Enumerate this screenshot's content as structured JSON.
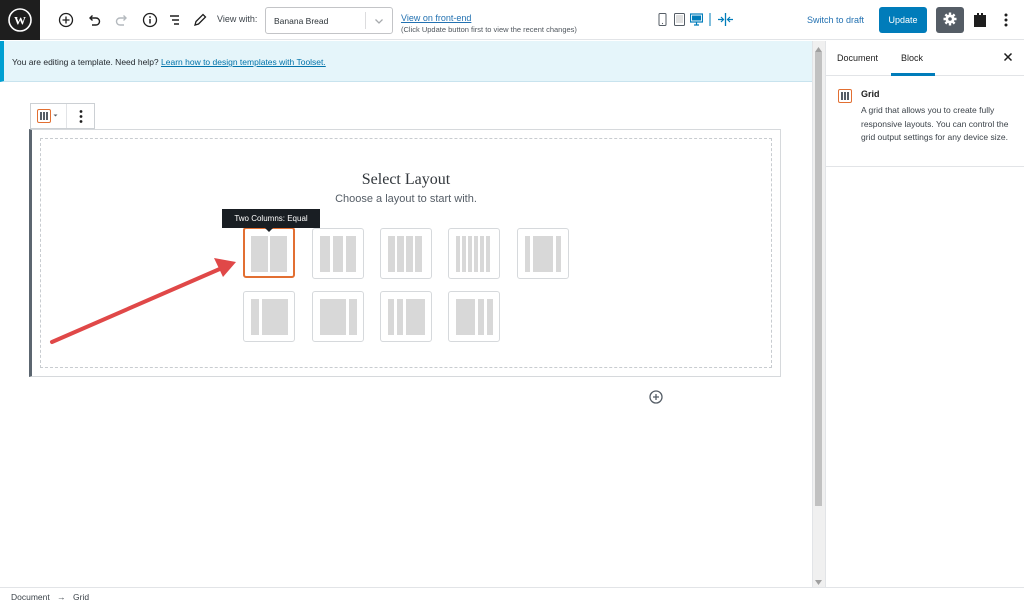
{
  "toolbar": {
    "view_with_label": "View with:",
    "view_with_value": "Banana Bread",
    "front_end_link": "View on front-end",
    "front_end_note": "(Click Update button first to view the recent changes)",
    "switch_to_draft": "Switch to draft",
    "update": "Update"
  },
  "notice": {
    "text": "You are editing a template. Need help? ",
    "link": "Learn how to design templates with Toolset."
  },
  "layout_picker": {
    "title": "Select Layout",
    "subtitle": "Choose a layout to start with.",
    "tooltip": "Two Columns: Equal",
    "selected_index": 0
  },
  "sidebar": {
    "tabs": [
      "Document",
      "Block"
    ],
    "active_tab": "Block",
    "block_name": "Grid",
    "block_description": "A grid that allows you to create fully responsive layouts. You can control the grid output settings for any device size."
  },
  "breadcrumb": {
    "root": "Document",
    "separator": "→",
    "current": "Grid"
  },
  "colors": {
    "accent": "#007cba",
    "selected_layout": "#e26f32",
    "notice_bg": "#e5f5fa",
    "annotation_arrow": "#e04848"
  }
}
